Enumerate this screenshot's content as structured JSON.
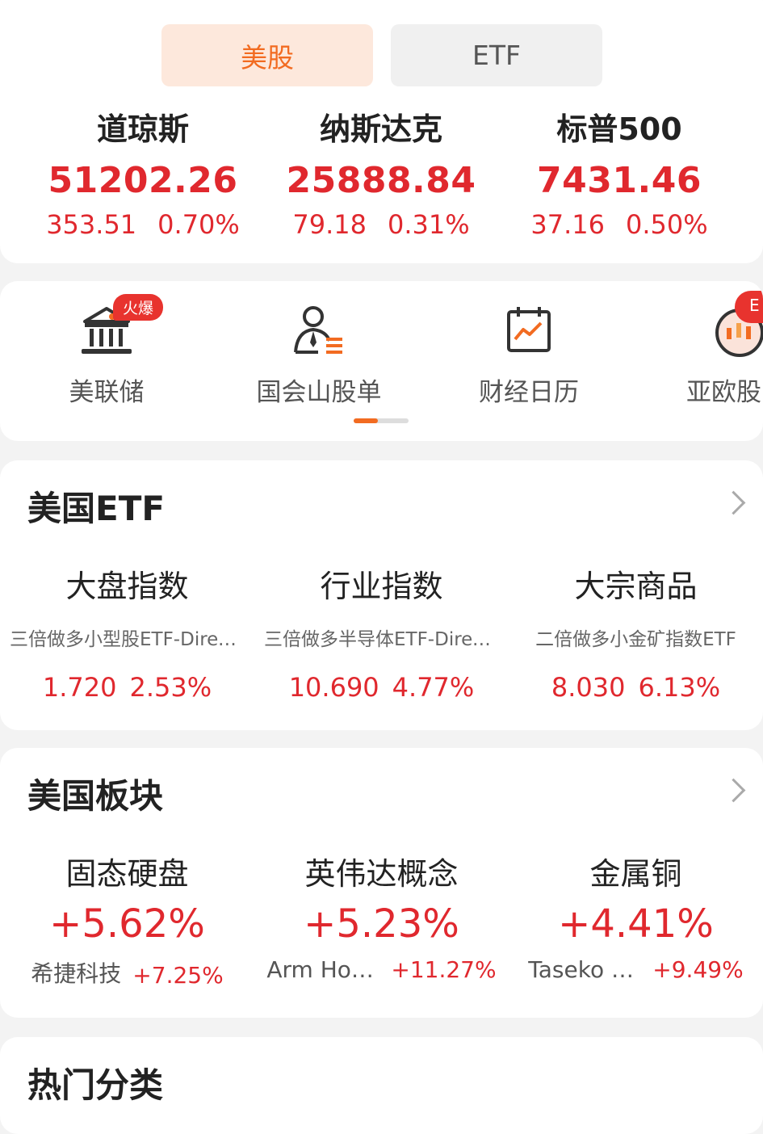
{
  "tabs": {
    "us_stocks": "美股",
    "etf": "ETF"
  },
  "indices": [
    {
      "name": "道琼斯",
      "price": "51202.26",
      "change": "353.51",
      "pct": "0.70%"
    },
    {
      "name": "纳斯达克",
      "price": "25888.84",
      "change": "79.18",
      "pct": "0.31%"
    },
    {
      "name": "标普500",
      "price": "7431.46",
      "change": "37.16",
      "pct": "0.50%"
    }
  ],
  "shortcuts": {
    "badge": "火爆",
    "items": [
      {
        "label": "美联储"
      },
      {
        "label": "国会山股单"
      },
      {
        "label": "财经日历"
      },
      {
        "label": "亚欧股"
      }
    ],
    "partial_badge": "E"
  },
  "us_etf": {
    "title": "美国ETF",
    "columns": [
      {
        "title": "大盘指数",
        "fund": "三倍做多小型股ETF-Direxion",
        "price": "1.720",
        "pct": "2.53%"
      },
      {
        "title": "行业指数",
        "fund": "三倍做多半导体ETF-Direxion",
        "price": "10.690",
        "pct": "4.77%"
      },
      {
        "title": "大宗商品",
        "fund": "二倍做多小金矿指数ETF",
        "price": "8.030",
        "pct": "6.13%"
      }
    ]
  },
  "us_sectors": {
    "title": "美国板块",
    "columns": [
      {
        "title": "固态硬盘",
        "pct": "+5.62%",
        "leader": "希捷科技",
        "leader_pct": "+7.25%"
      },
      {
        "title": "英伟达概念",
        "pct": "+5.23%",
        "leader": "Arm Holdings",
        "leader_pct": "+11.27%"
      },
      {
        "title": "金属铜",
        "pct": "+4.41%",
        "leader": "Taseko Mines",
        "leader_pct": "+9.49%"
      }
    ]
  },
  "hot_categories": {
    "title": "热门分类"
  },
  "colors": {
    "up": "#e0282e",
    "accent": "#f26b21",
    "tab_active_bg": "#fde8dc"
  }
}
